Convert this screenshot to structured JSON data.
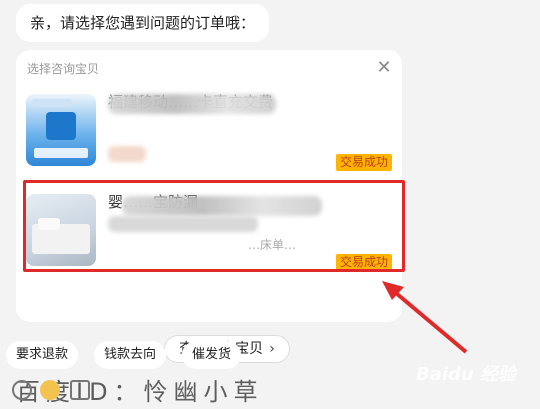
{
  "greeting": "亲，请选择您遇到问题的订单哦：",
  "picker": {
    "title": "选择咨询宝贝",
    "close_icon": "close-icon",
    "orders": [
      {
        "title": "福建移动……卡直充交费",
        "status": "交易成功",
        "thumb": "mobile-topup-thumbnail"
      },
      {
        "title": "婴……宝防漏",
        "subtitle": "…床单…",
        "status": "交易成功",
        "thumb": "bed-sheet-thumbnail"
      }
    ],
    "more_button": "查看更多宝贝",
    "more_chevron": "›"
  },
  "quick_actions": [
    "要求退款",
    "钱款去向",
    "催发货"
  ],
  "watermark": {
    "brand": "Baidu 经验",
    "author": "百度ID：怜幽小草"
  },
  "colors": {
    "status_bg": "#ffb400",
    "status_text": "#c0391b",
    "highlight": "#e02a2a"
  }
}
